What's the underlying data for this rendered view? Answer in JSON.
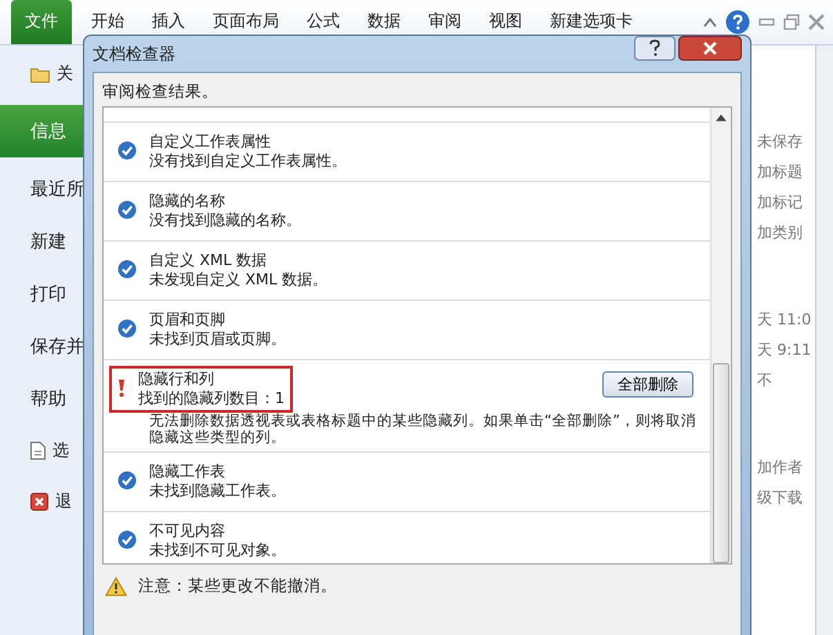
{
  "ribbon": {
    "tabs": [
      {
        "label": "文件",
        "selected": true
      },
      {
        "label": "开始",
        "selected": false
      },
      {
        "label": "插入",
        "selected": false
      },
      {
        "label": "页面布局",
        "selected": false
      },
      {
        "label": "公式",
        "selected": false
      },
      {
        "label": "数据",
        "selected": false
      },
      {
        "label": "审阅",
        "selected": false
      },
      {
        "label": "视图",
        "selected": false
      },
      {
        "label": "新建选项卡",
        "selected": false
      }
    ]
  },
  "backstage": {
    "menu": [
      {
        "label": "关",
        "kind": "file",
        "selected": false
      },
      {
        "label": "信息",
        "kind": "page",
        "selected": true
      },
      {
        "label": "最近所",
        "kind": "page",
        "selected": false
      },
      {
        "label": "新建",
        "kind": "page",
        "selected": false
      },
      {
        "label": "打印",
        "kind": "page",
        "selected": false
      },
      {
        "label": "保存并",
        "kind": "page",
        "selected": false
      },
      {
        "label": "帮助",
        "kind": "page",
        "selected": false
      },
      {
        "label": "选",
        "kind": "options",
        "selected": false
      },
      {
        "label": "退",
        "kind": "exit",
        "selected": false
      }
    ],
    "info_groups": [
      [
        "未保存",
        "加标题",
        "加标记",
        "加类别"
      ],
      [
        "天 11:0",
        "天 9:11",
        "不"
      ],
      [
        "加作者",
        "级下载"
      ]
    ]
  },
  "dialog": {
    "title": "文档检查器",
    "heading": "审阅检查结果。",
    "results": [
      {
        "kind": "passed",
        "title": "自定义工作表属性",
        "detail": "没有找到自定义工作表属性。"
      },
      {
        "kind": "passed",
        "title": "隐藏的名称",
        "detail": "没有找到隐藏的名称。"
      },
      {
        "kind": "passed",
        "title": "自定义 XML 数据",
        "detail": "未发现自定义 XML 数据。"
      },
      {
        "kind": "passed",
        "title": "页眉和页脚",
        "detail": "未找到页眉或页脚。"
      },
      {
        "kind": "found",
        "title": "隐藏行和列",
        "detail": "找到的隐藏列数目：1",
        "note": "无法删除数据透视表或表格标题中的某些隐藏列。如果单击“全部删除”，则将取消隐藏这些类型的列。",
        "action": "全部删除",
        "highlighted": true
      },
      {
        "kind": "passed",
        "title": "隐藏工作表",
        "detail": "未找到隐藏工作表。"
      },
      {
        "kind": "passed",
        "title": "不可见内容",
        "detail": "未找到不可见对象。"
      }
    ],
    "footer": "注意：某些更改不能撤消。"
  }
}
